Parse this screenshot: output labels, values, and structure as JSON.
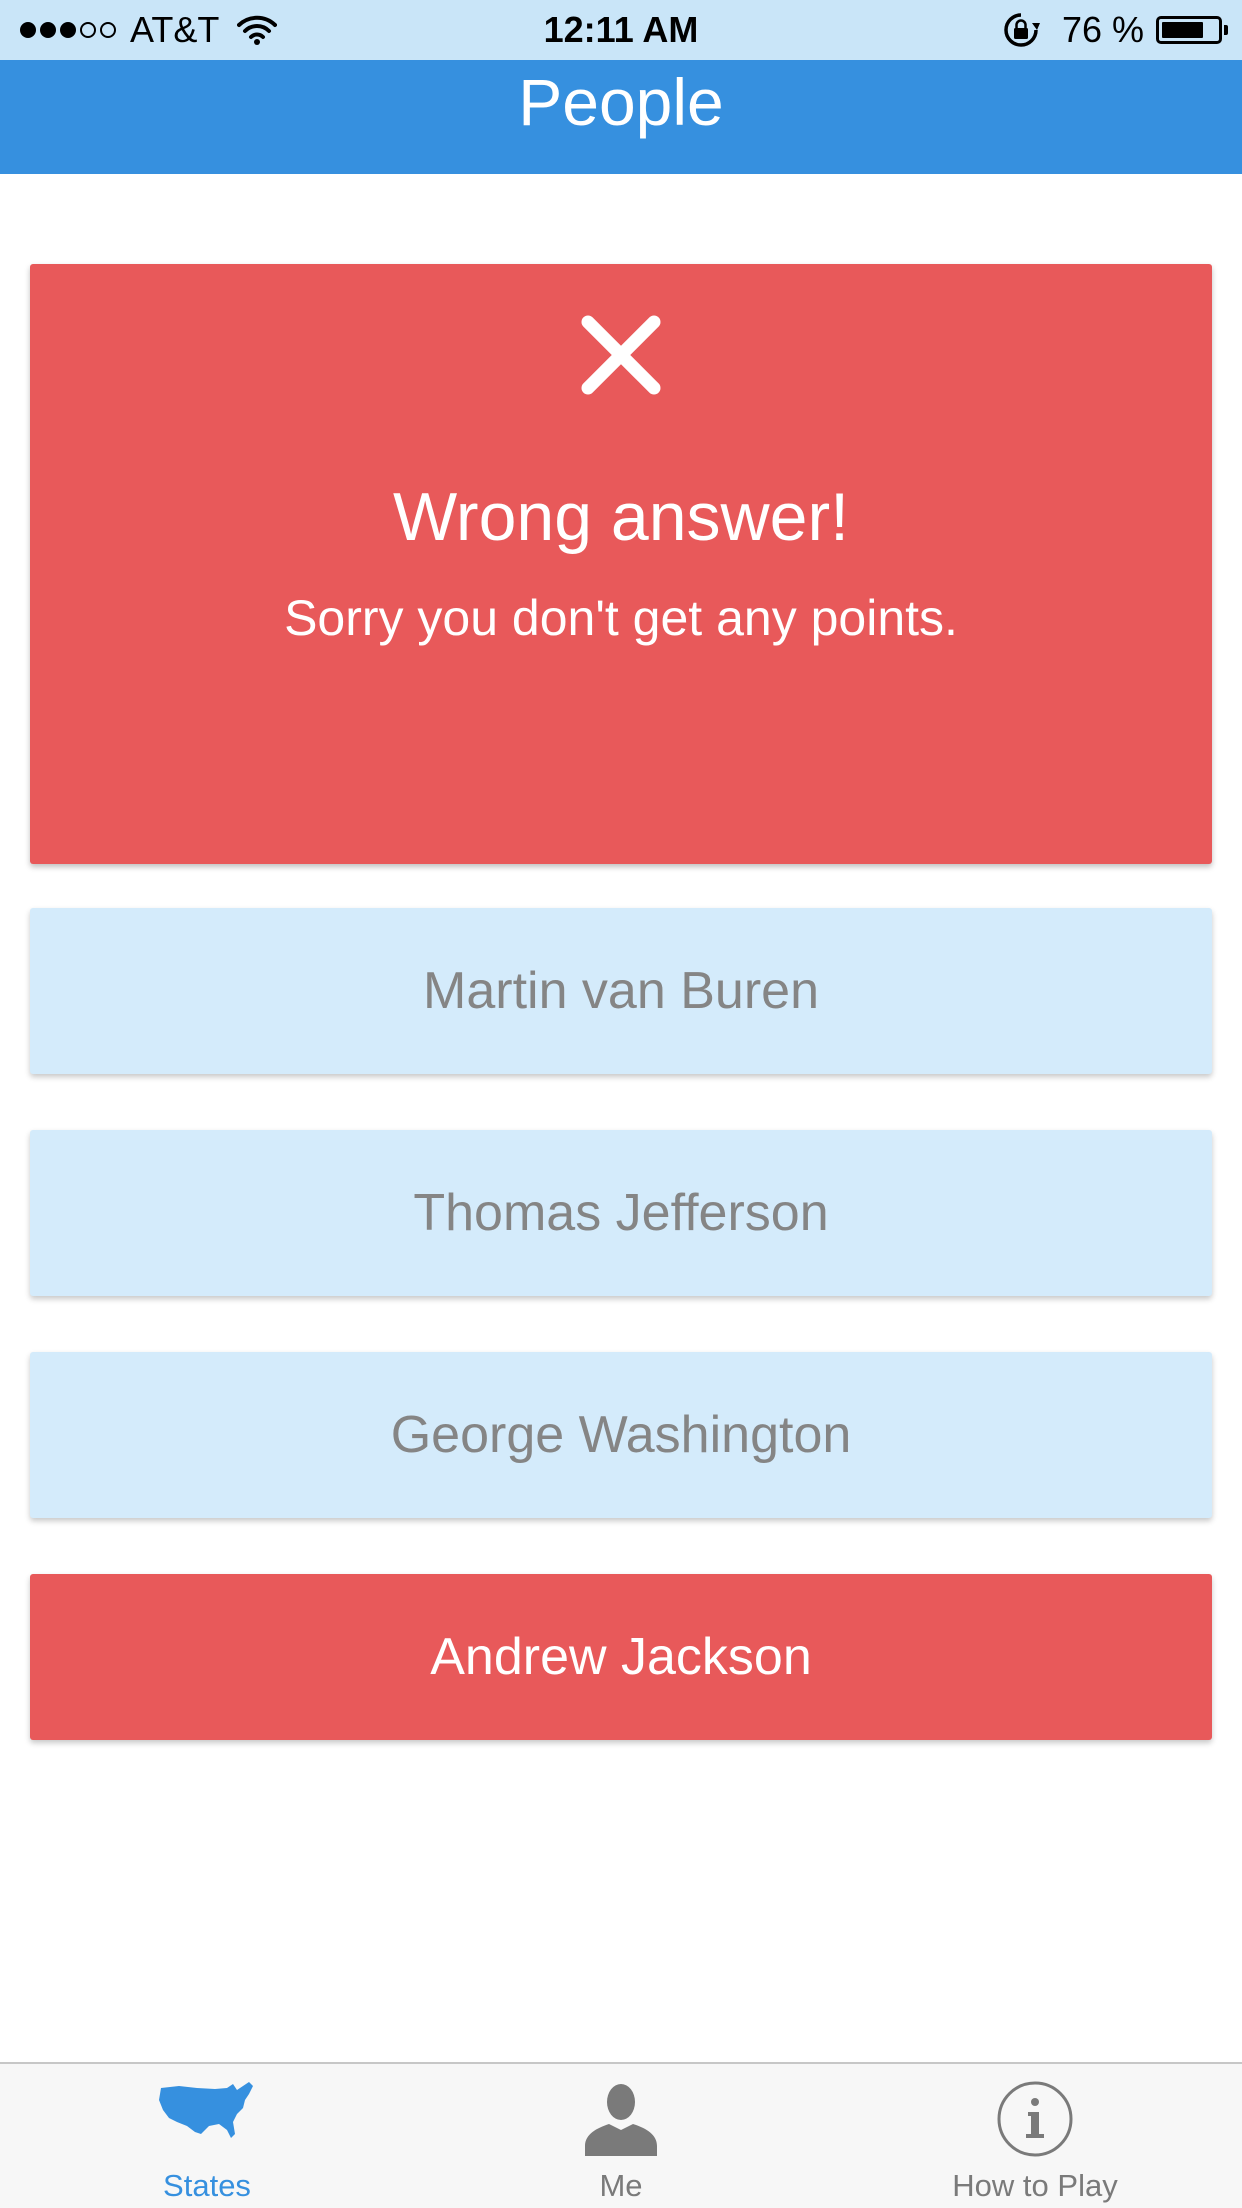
{
  "status_bar": {
    "carrier": "AT&T",
    "time": "12:11 AM",
    "battery_percent": "76 %",
    "battery_level": 0.76,
    "signal_bars_filled": 3,
    "signal_bars_total": 5
  },
  "nav": {
    "title": "People"
  },
  "result": {
    "icon": "close-icon",
    "title": "Wrong answer!",
    "message": "Sorry you don't get any points.",
    "color": "#e8595a"
  },
  "answers": [
    {
      "label": "Martin van Buren",
      "state": "neutral"
    },
    {
      "label": "Thomas Jefferson",
      "state": "neutral"
    },
    {
      "label": "George Washington",
      "state": "neutral"
    },
    {
      "label": "Andrew Jackson",
      "state": "wrong"
    }
  ],
  "tab_bar": {
    "tabs": [
      {
        "label": "States",
        "icon": "usa-map-icon",
        "active": true
      },
      {
        "label": "Me",
        "icon": "person-icon",
        "active": false
      },
      {
        "label": "How to Play",
        "icon": "info-icon",
        "active": false
      }
    ]
  },
  "colors": {
    "accent": "#3690df",
    "wrong": "#e8595a",
    "answer_background": "#d4ebfb",
    "status_bar_background": "#c9e5f8"
  }
}
